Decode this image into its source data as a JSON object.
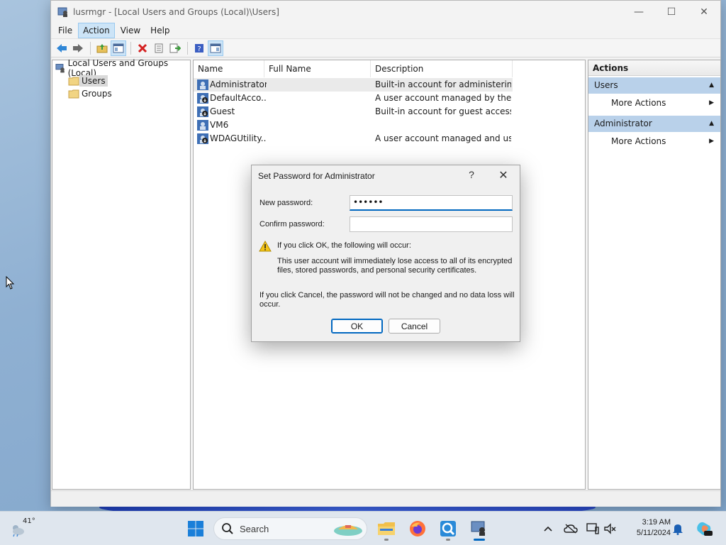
{
  "window": {
    "title": "lusrmgr - [Local Users and Groups (Local)\\Users]",
    "controls": {
      "minimize": "—",
      "maximize": "☐",
      "close": "✕"
    }
  },
  "menubar": {
    "items": [
      "File",
      "Action",
      "View",
      "Help"
    ],
    "active": "Action"
  },
  "toolbar": {
    "icons": [
      "back-arrow-icon",
      "forward-arrow-icon",
      "up-folder-icon",
      "show-hide-tree-icon",
      "delete-icon",
      "properties-icon",
      "export-list-icon",
      "help-icon",
      "show-hide-action-pane-icon"
    ]
  },
  "tree": {
    "root": "Local Users and Groups (Local)",
    "items": [
      "Users",
      "Groups"
    ],
    "selected": "Users"
  },
  "list": {
    "columns": [
      "Name",
      "Full Name",
      "Description"
    ],
    "rows": [
      {
        "name": "Administrator",
        "full_name": "",
        "description": "Built-in account for administering..."
      },
      {
        "name": "DefaultAcco...",
        "full_name": "",
        "description": "A user account managed by the s..."
      },
      {
        "name": "Guest",
        "full_name": "",
        "description": "Built-in account for guest access t..."
      },
      {
        "name": "VM6",
        "full_name": "",
        "description": ""
      },
      {
        "name": "WDAGUtility...",
        "full_name": "",
        "description": "A user account managed and use..."
      }
    ]
  },
  "actions": {
    "header": "Actions",
    "sections": [
      {
        "title": "Users",
        "items": [
          "More Actions"
        ]
      },
      {
        "title": "Administrator",
        "items": [
          "More Actions"
        ]
      }
    ]
  },
  "dialog": {
    "title": "Set Password for Administrator",
    "help": "?",
    "close": "✕",
    "new_password_label": "New password:",
    "new_password_value": "••••••",
    "confirm_password_label": "Confirm password:",
    "confirm_password_value": "",
    "warning_heading": "If you click OK, the following will occur:",
    "warning_body_1": "This user account will immediately lose access to all of its encrypted",
    "warning_body_2": "files, stored passwords, and personal security certificates.",
    "cancel_note_1": "If you click Cancel, the password will not be changed and no data loss will",
    "cancel_note_2": "occur.",
    "ok_label": "OK",
    "cancel_label": "Cancel"
  },
  "taskbar": {
    "weather_temp": "41°",
    "search_label": "Search",
    "clock_time": "3:19 AM",
    "clock_date": "5/11/2024",
    "accent": "#0067c0"
  }
}
